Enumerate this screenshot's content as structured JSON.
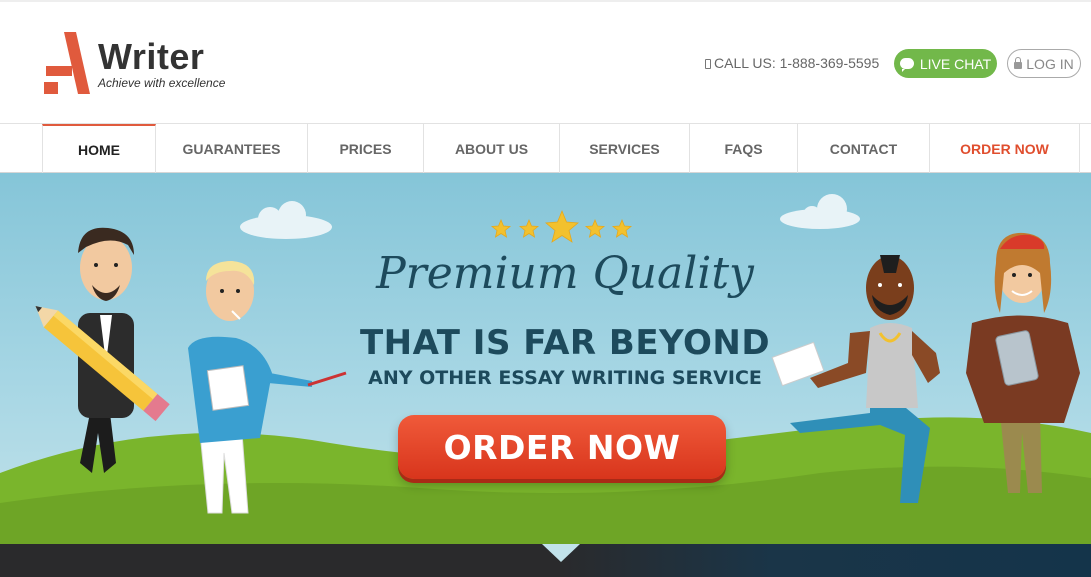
{
  "brand": {
    "name": "Writer",
    "tagline": "Achieve with excellence"
  },
  "header": {
    "phone_text": "CALL US: 1-888-369-5595",
    "live_chat_label": "LIVE CHAT",
    "login_label": "LOG IN"
  },
  "nav": {
    "items": [
      {
        "label": "HOME"
      },
      {
        "label": "GUARANTEES"
      },
      {
        "label": "PRICES"
      },
      {
        "label": "ABOUT US"
      },
      {
        "label": "SERVICES"
      },
      {
        "label": "FAQS"
      },
      {
        "label": "CONTACT"
      },
      {
        "label": "ORDER NOW"
      }
    ]
  },
  "hero": {
    "headline_script": "Premium Quality",
    "headline_main": "THAT IS FAR BEYOND",
    "headline_sub": "ANY OTHER ESSAY WRITING SERVICE",
    "cta_label": "ORDER NOW",
    "rating_stars": 5
  },
  "colors": {
    "accent": "#e04e2e",
    "live_chat": "#72b84a",
    "headline": "#1d4a5c",
    "sky": "#85c5d8",
    "grass": "#7ab52c"
  }
}
